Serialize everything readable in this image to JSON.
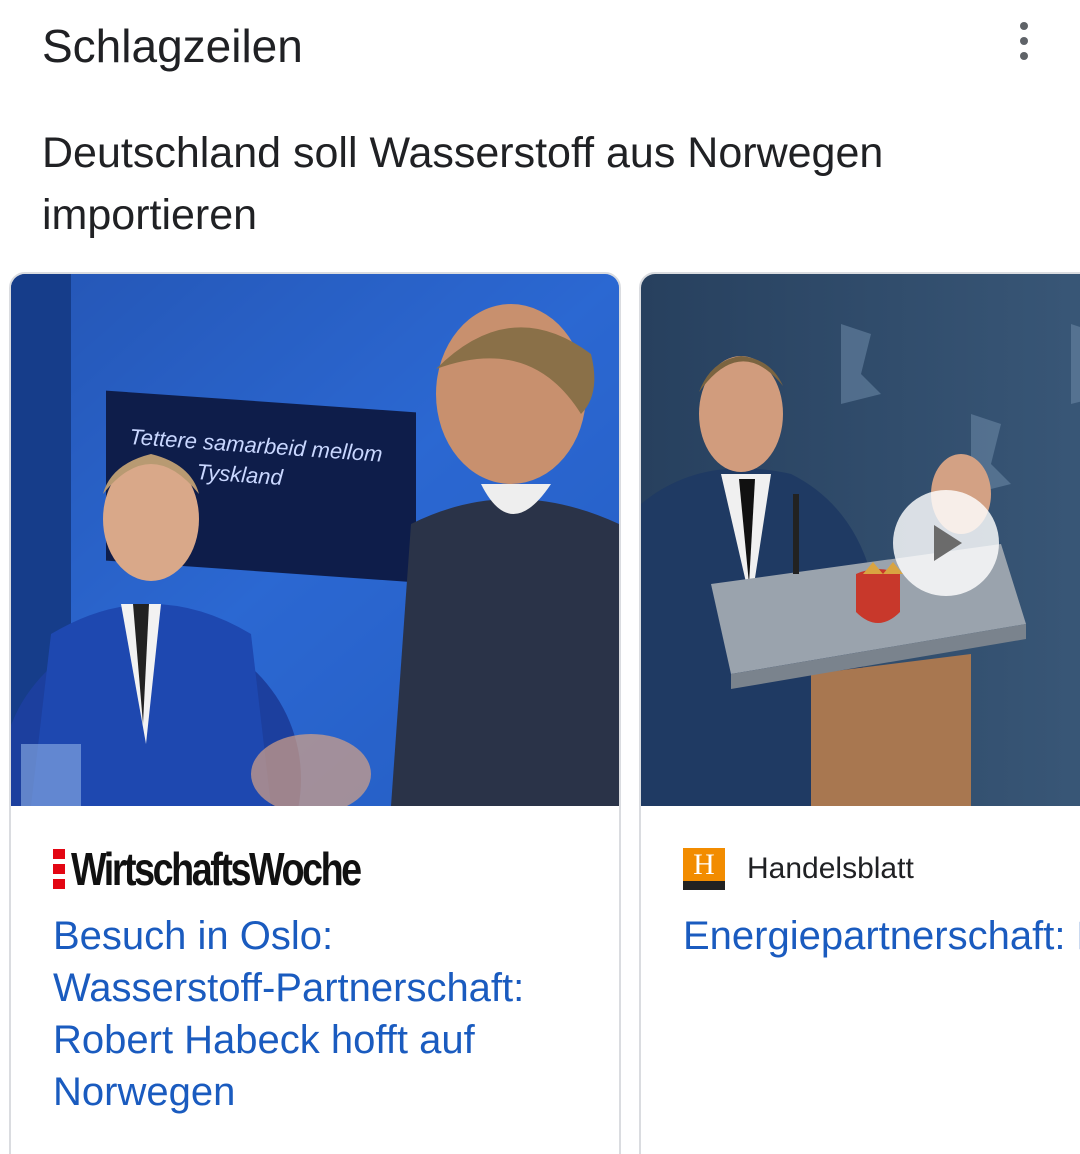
{
  "header": {
    "title": "Schlagzeilen",
    "more_icon": "more-vert-icon"
  },
  "story": {
    "title": "Deutschland soll Wasserstoff aus Norwegen importieren"
  },
  "cards": [
    {
      "source": "WirtschaftsWoche",
      "headline": "Besuch in Oslo:\nWasserstoff-Partnerschaft:\nRobert Habeck hofft auf\nNorwegen",
      "image_caption": "Tettere samarbeid mellom\nTyskland",
      "has_video": false
    },
    {
      "source": "Handelsblatt",
      "source_logo_letter": "H",
      "headline": "Energiepartnerschaft:\nHabeck: „Dekarbonisi\nWasserstoff sollte au\nNorwegen kommen“",
      "has_video": true,
      "play_icon": "play-icon"
    }
  ],
  "colors": {
    "headline_link": "#1a5bbf",
    "title_text": "#202124",
    "card_border": "#dadce0",
    "ww_red": "#e30613",
    "hb_orange": "#f28c00"
  }
}
